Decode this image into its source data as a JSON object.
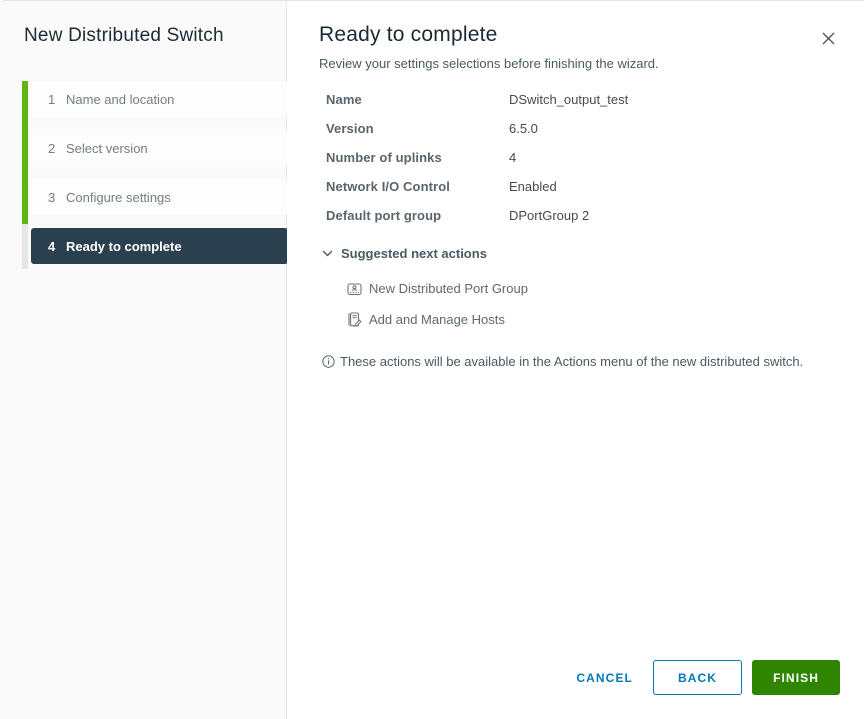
{
  "wizard": {
    "title": "New Distributed Switch",
    "steps": [
      {
        "number": "1",
        "label": "Name and location",
        "state": "completed"
      },
      {
        "number": "2",
        "label": "Select version",
        "state": "completed"
      },
      {
        "number": "3",
        "label": "Configure settings",
        "state": "completed"
      },
      {
        "number": "4",
        "label": "Ready to complete",
        "state": "current"
      }
    ]
  },
  "page": {
    "title": "Ready to complete",
    "subtitle": "Review your settings selections before finishing the wizard."
  },
  "summary": {
    "rows": [
      {
        "label": "Name",
        "value": "DSwitch_output_test"
      },
      {
        "label": "Version",
        "value": "6.5.0"
      },
      {
        "label": "Number of uplinks",
        "value": "4"
      },
      {
        "label": "Network I/O Control",
        "value": "Enabled"
      },
      {
        "label": "Default port group",
        "value": "DPortGroup 2"
      }
    ]
  },
  "suggested_actions": {
    "header": "Suggested next actions",
    "items": [
      {
        "label": "New Distributed Port Group",
        "icon": "port-group-icon"
      },
      {
        "label": "Add and Manage Hosts",
        "icon": "hosts-edit-icon"
      }
    ],
    "note": "These actions will be available in the Actions menu of the new distributed switch."
  },
  "footer": {
    "cancel_label": "CANCEL",
    "back_label": "BACK",
    "finish_label": "FINISH"
  },
  "colors": {
    "accent_blue": "#0079b8",
    "finish_green": "#2f8400",
    "progress_green": "#60b515",
    "current_step_bg": "#2b404e"
  }
}
